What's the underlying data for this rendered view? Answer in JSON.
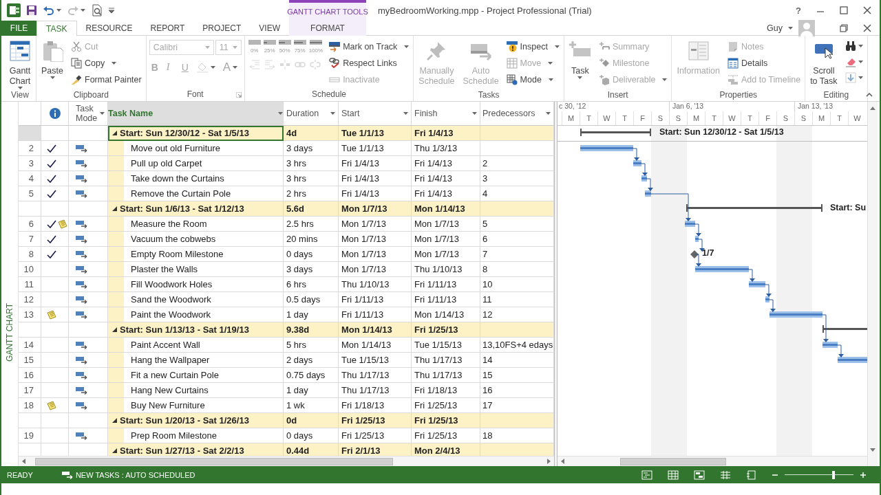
{
  "window": {
    "title": "myBedroomWorking.mpp - Project Professional (Trial)",
    "context_group": "GANTT CHART TOOLS",
    "help": "?",
    "user": "Guy"
  },
  "tabs": [
    {
      "label": "FILE",
      "kind": "file",
      "selected": false
    },
    {
      "label": "TASK",
      "kind": "normal",
      "selected": true
    },
    {
      "label": "RESOURCE",
      "kind": "normal",
      "selected": false
    },
    {
      "label": "REPORT",
      "kind": "normal",
      "selected": false
    },
    {
      "label": "PROJECT",
      "kind": "normal",
      "selected": false
    },
    {
      "label": "VIEW",
      "kind": "normal",
      "selected": false
    },
    {
      "label": "FORMAT",
      "kind": "context",
      "selected": false
    }
  ],
  "ribbon": {
    "groups": [
      {
        "title": "View",
        "parts": [
          {
            "kind": "large",
            "label": "Gantt\nChart",
            "dropdown": true,
            "disabled": false
          }
        ]
      },
      {
        "title": "Clipboard",
        "parts": [
          {
            "kind": "large",
            "label": "Paste",
            "dropdown": true,
            "disabled": false
          },
          {
            "kind": "stack",
            "items": [
              {
                "kind": "small",
                "label": "Cut",
                "dropdown": false,
                "disabled": true
              },
              {
                "kind": "small",
                "label": "Copy",
                "dropdown": true,
                "disabled": false
              },
              {
                "kind": "small",
                "label": "Format Painter",
                "dropdown": false,
                "disabled": false
              }
            ]
          }
        ]
      },
      {
        "title": "Font",
        "launcher": true,
        "parts": [
          {
            "kind": "stack",
            "items": [
              {
                "kind": "strip",
                "items": [
                  {
                    "kind": "field",
                    "value": "Calibri",
                    "wide": true,
                    "disabled": true
                  },
                  {
                    "kind": "field",
                    "value": "11",
                    "wide": false,
                    "disabled": true
                  }
                ]
              },
              {
                "kind": "strip",
                "items": [
                  {
                    "kind": "letter",
                    "label": "B",
                    "dropdown": false,
                    "disabled": true
                  },
                  {
                    "kind": "letter",
                    "label": "I",
                    "dropdown": false,
                    "disabled": true
                  },
                  {
                    "kind": "letter",
                    "label": "U",
                    "dropdown": false,
                    "disabled": true
                  },
                  {
                    "kind": "icon",
                    "dropdown": true,
                    "disabled": true
                  },
                  {
                    "kind": "letter",
                    "label": "A",
                    "dropdown": true,
                    "disabled": true
                  }
                ]
              }
            ]
          }
        ]
      },
      {
        "title": "Schedule",
        "parts": [
          {
            "kind": "stack",
            "items": [
              {
                "kind": "strip",
                "items": [
                  {
                    "kind": "percent",
                    "label": "0%",
                    "disabled": true
                  },
                  {
                    "kind": "percent",
                    "label": "25%",
                    "disabled": true
                  },
                  {
                    "kind": "percent",
                    "label": "50%",
                    "disabled": true
                  },
                  {
                    "kind": "percent",
                    "label": "75%",
                    "disabled": true
                  },
                  {
                    "kind": "percent",
                    "label": "100%",
                    "disabled": true
                  }
                ]
              },
              {
                "kind": "strip",
                "items": [
                  {
                    "kind": "icon",
                    "dropdown": false,
                    "disabled": true
                  },
                  {
                    "kind": "icon",
                    "dropdown": false,
                    "disabled": true
                  },
                  {
                    "kind": "icon",
                    "dropdown": false,
                    "disabled": true
                  },
                  {
                    "kind": "icon",
                    "dropdown": false,
                    "disabled": true
                  },
                  {
                    "kind": "icon",
                    "dropdown": false,
                    "disabled": true
                  }
                ]
              }
            ]
          },
          {
            "kind": "stack",
            "items": [
              {
                "kind": "small",
                "label": "Mark on Track",
                "dropdown": true,
                "disabled": false
              },
              {
                "kind": "small",
                "label": "Respect Links",
                "dropdown": false,
                "disabled": false
              },
              {
                "kind": "small",
                "label": "Inactivate",
                "dropdown": false,
                "disabled": true
              }
            ]
          }
        ]
      },
      {
        "title": "Tasks",
        "parts": [
          {
            "kind": "large",
            "label": "Manually\nSchedule",
            "dropdown": false,
            "disabled": true
          },
          {
            "kind": "large",
            "label": "Auto\nSchedule",
            "dropdown": false,
            "disabled": true
          },
          {
            "kind": "stack",
            "items": [
              {
                "kind": "small",
                "label": "Inspect",
                "dropdown": true,
                "disabled": false
              },
              {
                "kind": "small",
                "label": "Move",
                "dropdown": true,
                "disabled": true
              },
              {
                "kind": "small",
                "label": "Mode",
                "dropdown": true,
                "disabled": false
              }
            ]
          }
        ]
      },
      {
        "title": "Insert",
        "parts": [
          {
            "kind": "large",
            "label": "Task",
            "dropdown": true,
            "disabled": false
          },
          {
            "kind": "stack",
            "items": [
              {
                "kind": "small",
                "label": "Summary",
                "dropdown": false,
                "disabled": true
              },
              {
                "kind": "small",
                "label": "Milestone",
                "dropdown": false,
                "disabled": true
              },
              {
                "kind": "small",
                "label": "Deliverable",
                "dropdown": true,
                "disabled": true
              }
            ]
          }
        ]
      },
      {
        "title": "Properties",
        "parts": [
          {
            "kind": "large",
            "label": "Information",
            "dropdown": false,
            "disabled": true
          },
          {
            "kind": "stack",
            "items": [
              {
                "kind": "small",
                "label": "Notes",
                "dropdown": false,
                "disabled": true
              },
              {
                "kind": "small",
                "label": "Details",
                "dropdown": false,
                "disabled": false
              },
              {
                "kind": "small",
                "label": "Add to Timeline",
                "dropdown": false,
                "disabled": true
              }
            ]
          }
        ]
      },
      {
        "title": "Editing",
        "parts": [
          {
            "kind": "large",
            "label": "Scroll\nto Task",
            "dropdown": false,
            "disabled": false
          },
          {
            "kind": "stack",
            "items": [
              {
                "kind": "icon",
                "dropdown": true,
                "disabled": false
              },
              {
                "kind": "icon",
                "dropdown": true,
                "disabled": false
              },
              {
                "kind": "icon",
                "dropdown": true,
                "disabled": true
              }
            ]
          }
        ]
      }
    ]
  },
  "view_label": "GANTT CHART",
  "table": {
    "columns": [
      {
        "label": "Task\nMode",
        "filter": true,
        "selected": false
      },
      {
        "label": "Task Name",
        "filter": true,
        "selected": true
      },
      {
        "label": "Duration",
        "filter": true,
        "selected": false
      },
      {
        "label": "Start",
        "filter": true,
        "selected": false
      },
      {
        "label": "Finish",
        "filter": true,
        "selected": false
      },
      {
        "label": "Predecessors",
        "filter": true,
        "selected": false
      }
    ],
    "rows": [
      {
        "kind": "summary",
        "expanded": true,
        "selected": true,
        "name": "Start: Sun 12/30/12 - Sat 1/5/13",
        "duration": "4d",
        "start": "Tue 1/1/13",
        "finish": "Fri 1/4/13"
      },
      {
        "kind": "task",
        "id": "2",
        "done": true,
        "note": false,
        "selected": false,
        "name": "Move out old Furniture",
        "duration": "3 days",
        "start": "Tue 1/1/13",
        "finish": "Thu 1/3/13"
      },
      {
        "kind": "task",
        "id": "3",
        "done": true,
        "note": false,
        "selected": false,
        "name": "Pull up old Carpet",
        "duration": "3 hrs",
        "start": "Fri 1/4/13",
        "finish": "Fri 1/4/13",
        "predecessors": "2"
      },
      {
        "kind": "task",
        "id": "4",
        "done": true,
        "note": false,
        "selected": false,
        "name": "Take down the Curtains",
        "duration": "3 hrs",
        "start": "Fri 1/4/13",
        "finish": "Fri 1/4/13",
        "predecessors": "3"
      },
      {
        "kind": "task",
        "id": "5",
        "done": true,
        "note": false,
        "selected": false,
        "name": "Remove the Curtain Pole",
        "duration": "2 hrs",
        "start": "Fri 1/4/13",
        "finish": "Fri 1/4/13",
        "predecessors": "4"
      },
      {
        "kind": "summary",
        "expanded": true,
        "selected": false,
        "name": "Start: Sun 1/6/13 - Sat 1/12/13",
        "duration": "5.6d",
        "start": "Mon 1/7/13",
        "finish": "Mon 1/14/13"
      },
      {
        "kind": "task",
        "id": "6",
        "done": true,
        "note": true,
        "selected": false,
        "name": "Measure the Room",
        "duration": "2.5 hrs",
        "start": "Mon 1/7/13",
        "finish": "Mon 1/7/13",
        "predecessors": "5"
      },
      {
        "kind": "task",
        "id": "7",
        "done": true,
        "note": false,
        "selected": false,
        "name": "Vacuum the cobwebs",
        "duration": "20 mins",
        "start": "Mon 1/7/13",
        "finish": "Mon 1/7/13",
        "predecessors": "6"
      },
      {
        "kind": "task",
        "id": "8",
        "done": true,
        "note": false,
        "selected": false,
        "name": "Empty Room Milestone",
        "duration": "0 days",
        "start": "Mon 1/7/13",
        "finish": "Mon 1/7/13",
        "predecessors": "7"
      },
      {
        "kind": "task",
        "id": "10",
        "done": false,
        "note": false,
        "selected": false,
        "name": "Plaster the Walls",
        "duration": "3 days",
        "start": "Mon 1/7/13",
        "finish": "Thu 1/10/13",
        "predecessors": "8"
      },
      {
        "kind": "task",
        "id": "11",
        "done": false,
        "note": false,
        "selected": false,
        "name": "Fill Woodwork Holes",
        "duration": "6 hrs",
        "start": "Thu 1/10/13",
        "finish": "Fri 1/11/13",
        "predecessors": "10"
      },
      {
        "kind": "task",
        "id": "12",
        "done": false,
        "note": false,
        "selected": false,
        "name": "Sand the Woodwork",
        "duration": "0.5 days",
        "start": "Fri 1/11/13",
        "finish": "Fri 1/11/13",
        "predecessors": "11"
      },
      {
        "kind": "task",
        "id": "13",
        "done": false,
        "note": true,
        "selected": false,
        "name": "Paint the Woodwork",
        "duration": "1 day",
        "start": "Fri 1/11/13",
        "finish": "Mon 1/14/13",
        "predecessors": "12"
      },
      {
        "kind": "summary",
        "expanded": true,
        "selected": false,
        "name": "Start: Sun 1/13/13 - Sat 1/19/13",
        "duration": "9.38d",
        "start": "Mon 1/14/13",
        "finish": "Fri 1/25/13"
      },
      {
        "kind": "task",
        "id": "14",
        "done": false,
        "note": false,
        "selected": false,
        "name": "Paint Accent Wall",
        "duration": "5 hrs",
        "start": "Mon 1/14/13",
        "finish": "Tue 1/15/13",
        "predecessors": "13,10FS+4 edays"
      },
      {
        "kind": "task",
        "id": "15",
        "done": false,
        "note": false,
        "selected": false,
        "name": "Hang the Wallpaper",
        "duration": "2 days",
        "start": "Tue 1/15/13",
        "finish": "Thu 1/17/13",
        "predecessors": "14"
      },
      {
        "kind": "task",
        "id": "16",
        "done": false,
        "note": false,
        "selected": false,
        "name": "Fit a new Curtain Pole",
        "duration": "0.75 days",
        "start": "Thu 1/17/13",
        "finish": "Thu 1/17/13",
        "predecessors": "15"
      },
      {
        "kind": "task",
        "id": "17",
        "done": false,
        "note": false,
        "selected": false,
        "name": "Hang New Curtains",
        "duration": "1 day",
        "start": "Thu 1/17/13",
        "finish": "Fri 1/18/13",
        "predecessors": "16"
      },
      {
        "kind": "task",
        "id": "18",
        "done": false,
        "note": true,
        "selected": false,
        "name": "Buy New Furniture",
        "duration": "1 wk",
        "start": "Fri 1/18/13",
        "finish": "Fri 1/25/13",
        "predecessors": "17"
      },
      {
        "kind": "summary",
        "expanded": true,
        "selected": false,
        "name": "Start: Sun 1/20/13 - Sat 1/26/13",
        "duration": "0d",
        "start": "Fri 1/25/13",
        "finish": "Fri 1/25/13"
      },
      {
        "kind": "task",
        "id": "19",
        "done": false,
        "note": false,
        "selected": false,
        "name": "Prep Room Milestone",
        "duration": "0 days",
        "start": "Fri 1/25/13",
        "finish": "Fri 1/25/13",
        "predecessors": "18"
      },
      {
        "kind": "summary",
        "expanded": true,
        "selected": false,
        "name": "Start: Sun 1/27/13 - Sat 2/2/13",
        "duration": "0.44d",
        "start": "Fri 2/1/13",
        "finish": "Mon 2/4/13"
      }
    ]
  },
  "gantt": {
    "weeks": [
      "c 30, '12",
      "Jan 6, '13",
      "Jan 13, '13"
    ],
    "days": [
      "M",
      "T",
      "W",
      "T",
      "F",
      "S",
      "S",
      "M",
      "T",
      "W",
      "T",
      "F",
      "S",
      "S",
      "M",
      "T",
      "W"
    ],
    "bar_labels": [
      "Start: Sun 12/30/12 - Sat 1/5/13",
      "Start: Su",
      "1/7"
    ]
  },
  "status_bar": {
    "ready": "READY",
    "new_tasks": "NEW TASKS : AUTO SCHEDULED",
    "zoom": {
      "level": 0.71
    }
  }
}
